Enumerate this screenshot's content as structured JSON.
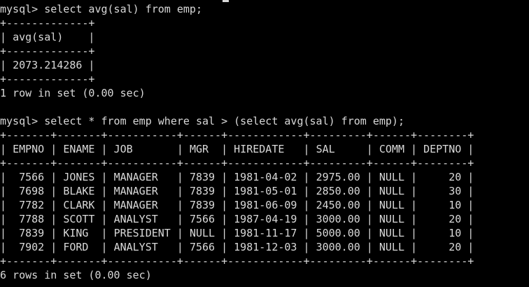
{
  "prompt": "mysql>",
  "query_1": {
    "command": "select avg(sal) from emp;",
    "columns": [
      "avg(sal)"
    ],
    "rows": [
      [
        "2073.214286"
      ]
    ],
    "summary": "1 row in set (0.00 sec)"
  },
  "query_2": {
    "command": "select * from emp where sal > (select avg(sal) from emp);",
    "columns": [
      "EMPNO",
      "ENAME",
      "JOB",
      "MGR",
      "HIREDATE",
      "SAL",
      "COMM",
      "DEPTNO"
    ],
    "rows": [
      [
        "7566",
        "JONES",
        "MANAGER",
        "7839",
        "1981-04-02",
        "2975.00",
        "NULL",
        "20"
      ],
      [
        "7698",
        "BLAKE",
        "MANAGER",
        "7839",
        "1981-05-01",
        "2850.00",
        "NULL",
        "30"
      ],
      [
        "7782",
        "CLARK",
        "MANAGER",
        "7839",
        "1981-06-09",
        "2450.00",
        "NULL",
        "10"
      ],
      [
        "7788",
        "SCOTT",
        "ANALYST",
        "7566",
        "1987-04-19",
        "3000.00",
        "NULL",
        "20"
      ],
      [
        "7839",
        "KING",
        "PRESIDENT",
        "NULL",
        "1981-11-17",
        "5000.00",
        "NULL",
        "10"
      ],
      [
        "7902",
        "FORD",
        "ANALYST",
        "7566",
        "1981-12-03",
        "3000.00",
        "NULL",
        "20"
      ]
    ],
    "summary": "6 rows in set (0.00 sec)"
  },
  "colors": {
    "background": "#000000",
    "foreground": "#d9d9d9"
  }
}
